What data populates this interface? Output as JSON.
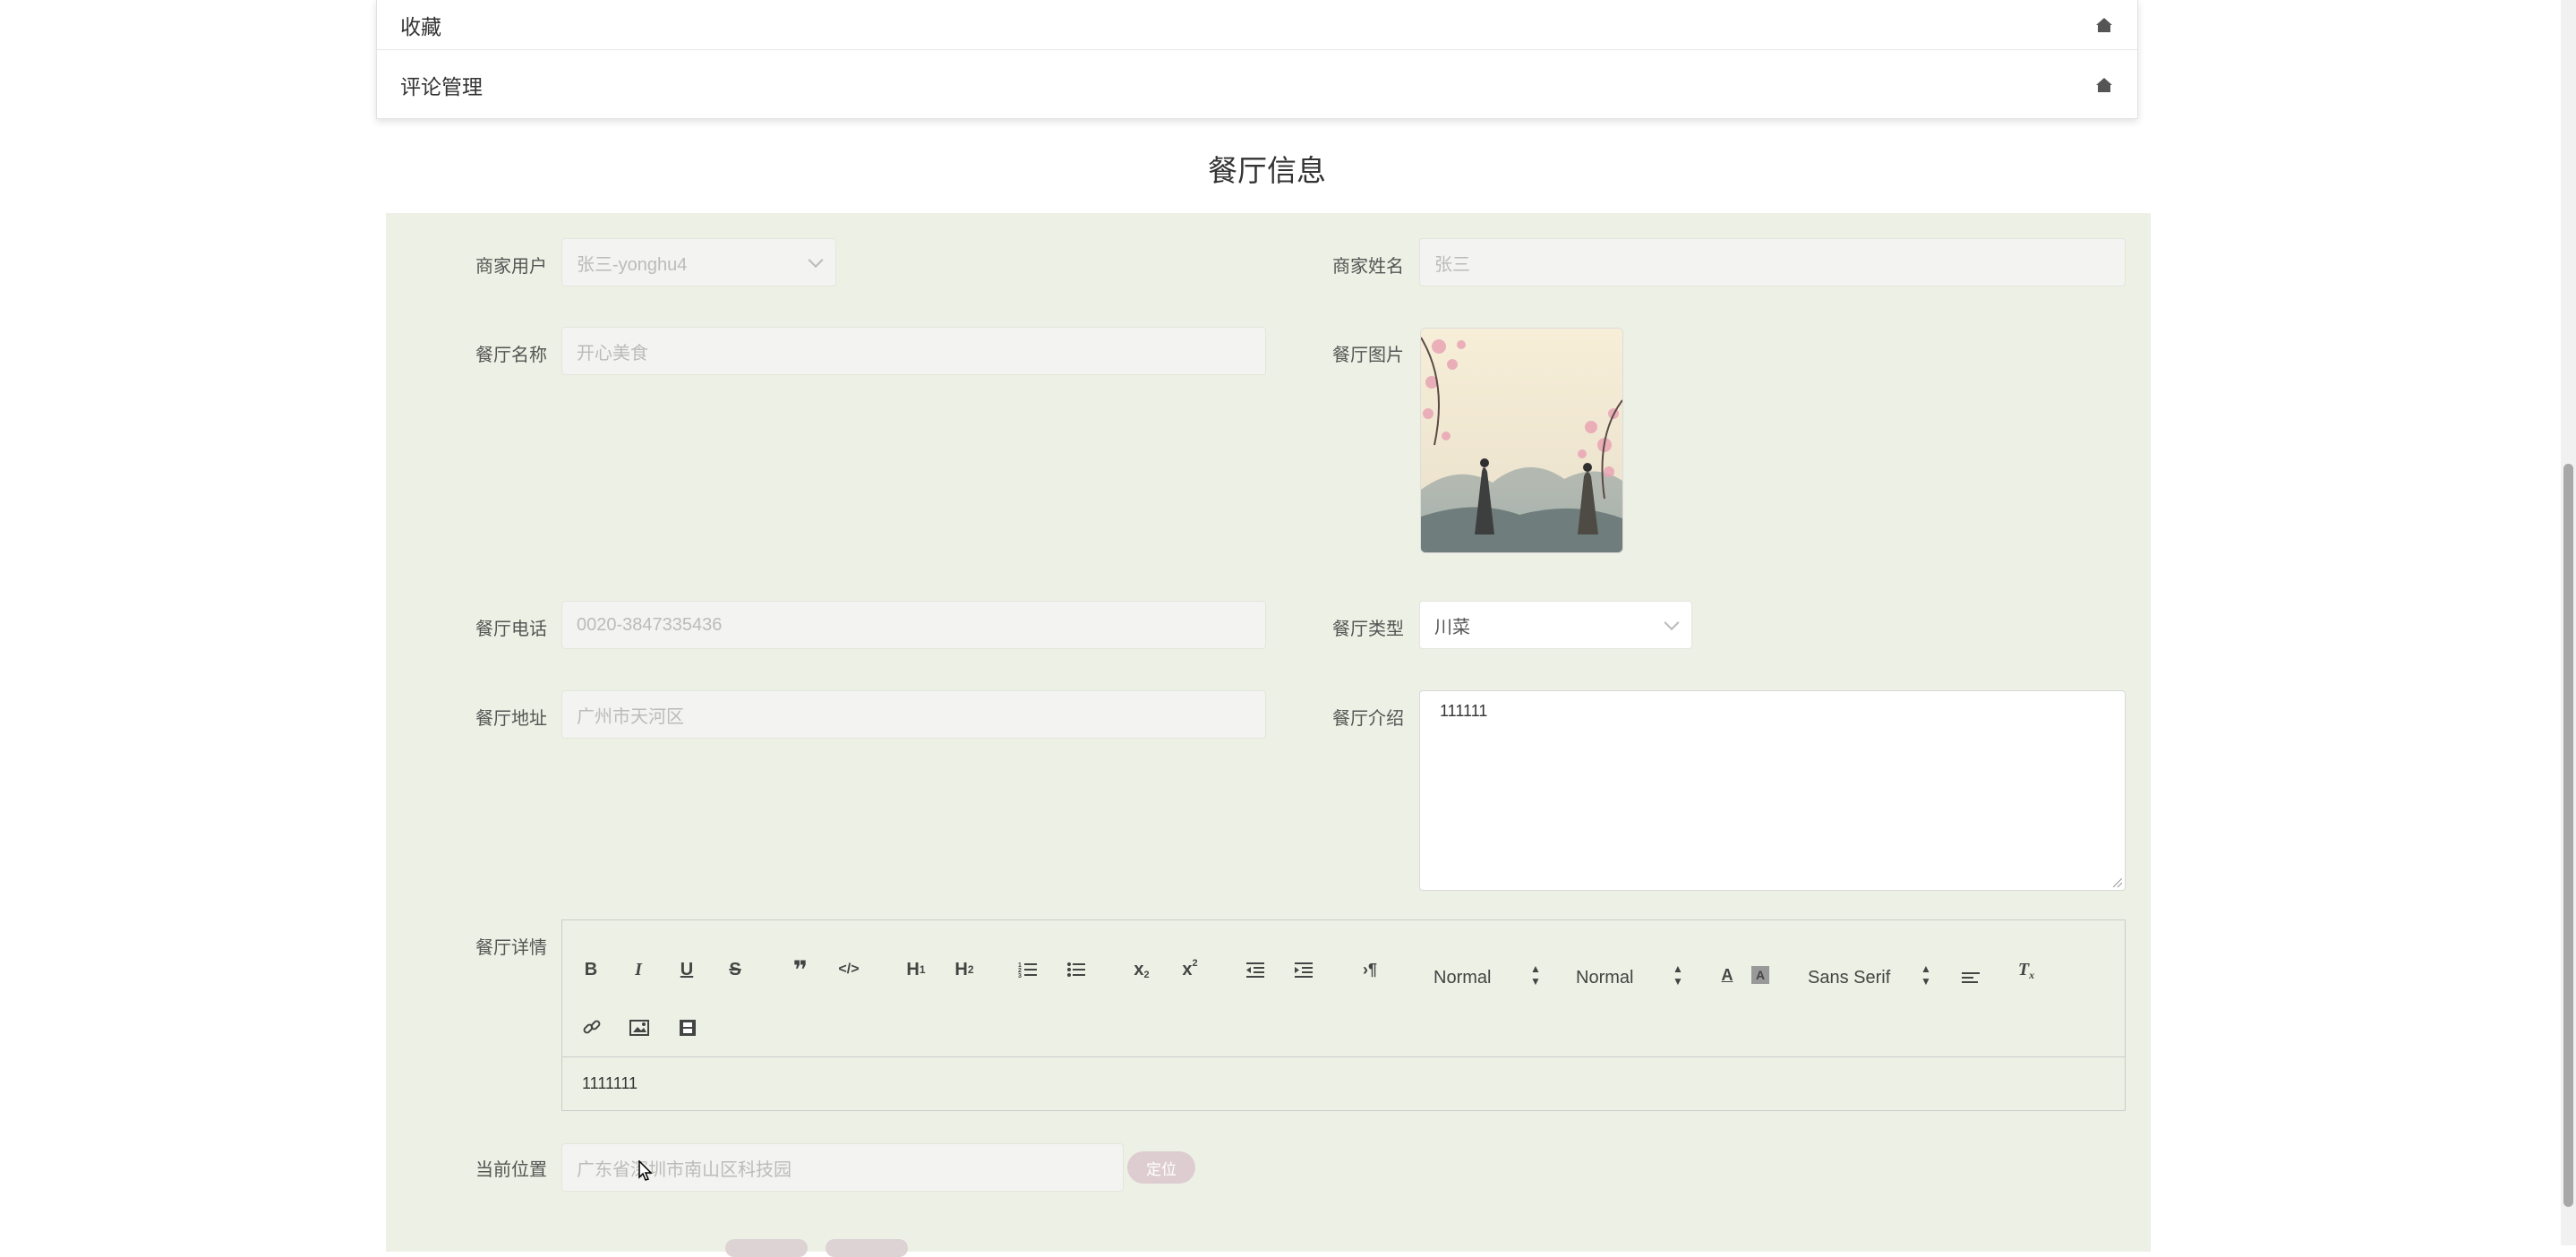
{
  "menu": {
    "items": [
      {
        "label": "收藏",
        "icon": "house-icon"
      },
      {
        "label": "评论管理",
        "icon": "house-icon"
      }
    ]
  },
  "page_title": "餐厅信息",
  "form": {
    "merchant_user_label": "商家用户",
    "merchant_user_value": "张三-yonghu4",
    "merchant_name_label": "商家姓名",
    "merchant_name_placeholder": "张三",
    "restaurant_name_label": "餐厅名称",
    "restaurant_name_placeholder": "开心美食",
    "restaurant_image_label": "餐厅图片",
    "restaurant_phone_label": "餐厅电话",
    "restaurant_phone_placeholder": "0020-3847335436",
    "restaurant_type_label": "餐厅类型",
    "restaurant_type_value": "川菜",
    "restaurant_address_label": "餐厅地址",
    "restaurant_address_placeholder": "广州市天河区",
    "restaurant_intro_label": "餐厅介绍",
    "restaurant_intro_value": "111111",
    "restaurant_detail_label": "餐厅详情",
    "editor": {
      "header_select": "Normal",
      "size_select": "Normal",
      "font_select": "Sans Serif",
      "content": "1111111"
    },
    "location_label": "当前位置",
    "location_placeholder": "广东省深圳市南山区科技园",
    "locate_button": "定位"
  },
  "colors": {
    "panel_bg": "#edf0e4",
    "button_pink": "#ddcdd1"
  }
}
